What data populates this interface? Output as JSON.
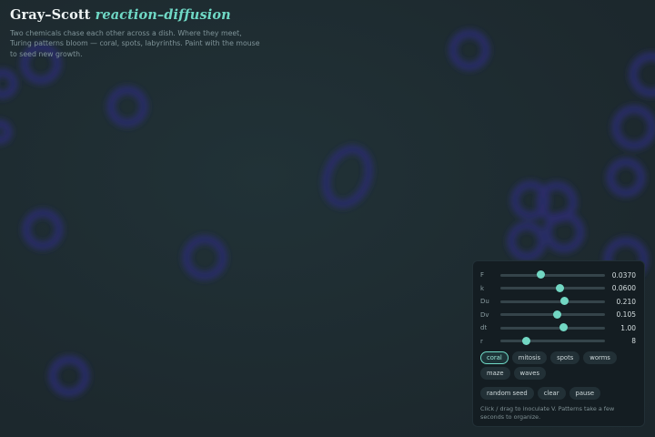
{
  "header": {
    "title_main": "Gray–Scott",
    "title_accent": "reaction–diffusion",
    "subtitle": "Two chemicals chase each other across a dish. Where they meet, Turing patterns bloom — coral, spots, labyrinths. Paint with the mouse to seed new growth."
  },
  "controls": {
    "sliders": [
      {
        "label": "F",
        "value": "0.0370",
        "fraction": 0.39
      },
      {
        "label": "k",
        "value": "0.0600",
        "fraction": 0.57
      },
      {
        "label": "Du",
        "value": "0.210",
        "fraction": 0.61
      },
      {
        "label": "Dv",
        "value": "0.105",
        "fraction": 0.54
      },
      {
        "label": "dt",
        "value": "1.00",
        "fraction": 0.6
      },
      {
        "label": "r",
        "value": "8",
        "fraction": 0.25
      }
    ],
    "presets": [
      "coral",
      "mitosis",
      "spots",
      "worms",
      "maze",
      "waves"
    ],
    "active_preset": "coral",
    "actions": [
      "random seed",
      "clear",
      "pause"
    ],
    "hint": "Click / drag to inoculate V. Patterns take a few seconds to organize."
  },
  "colors": {
    "background": "#1e2b30",
    "accent": "#6fd8c5",
    "blob": "#2a2d66"
  }
}
